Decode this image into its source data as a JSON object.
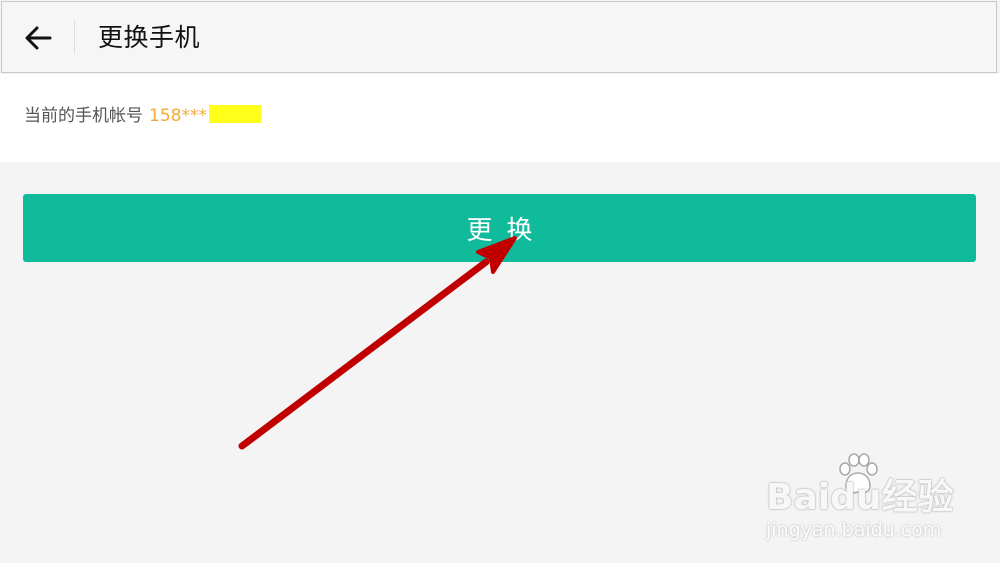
{
  "header": {
    "back_icon": "arrow-left-icon",
    "title": "更换手机"
  },
  "account": {
    "label": "当前的手机帐号",
    "phone_prefix": "158***",
    "redaction_color": "#ffff1a"
  },
  "action": {
    "change_label": "更换",
    "color": "#10bb9b"
  },
  "annotation": {
    "arrow_color": "#c00000"
  },
  "watermark": {
    "brand": "Baidu经验",
    "url": "jingyan.baidu.com"
  }
}
